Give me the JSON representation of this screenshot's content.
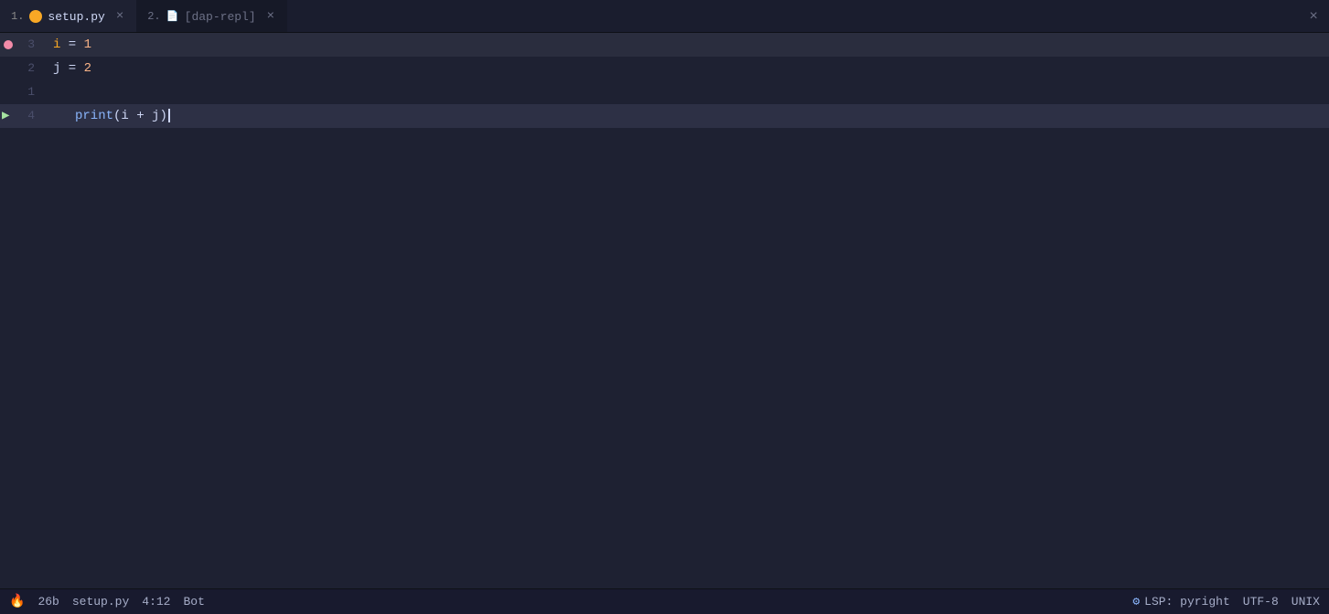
{
  "tabs": [
    {
      "number": "1.",
      "icon_type": "python",
      "name": "setup.py",
      "active": true,
      "closeable": true
    },
    {
      "number": "2.",
      "icon_type": "file",
      "name": "[dap-repl]",
      "active": false,
      "closeable": true
    }
  ],
  "window_close_label": "×",
  "code_lines": [
    {
      "line_num": "3",
      "content": "i = 1",
      "has_breakpoint": true,
      "highlighted": true,
      "debug_arrow": false
    },
    {
      "line_num": "2",
      "content": "j = 2",
      "has_breakpoint": false,
      "highlighted": false,
      "debug_arrow": false
    },
    {
      "line_num": "1",
      "content": "",
      "has_breakpoint": false,
      "highlighted": false,
      "debug_arrow": false
    },
    {
      "line_num": "4",
      "content": "print(i + j)",
      "has_breakpoint": false,
      "highlighted": true,
      "debug_arrow": true,
      "current": true
    }
  ],
  "status_bar": {
    "flame_icon": "🔥",
    "file_size": "26b",
    "filename": "setup.py",
    "cursor_position": "4:12",
    "mode": "Bot",
    "lsp_label": "LSP: pyright",
    "encoding": "UTF-8",
    "line_ending": "UNIX"
  }
}
